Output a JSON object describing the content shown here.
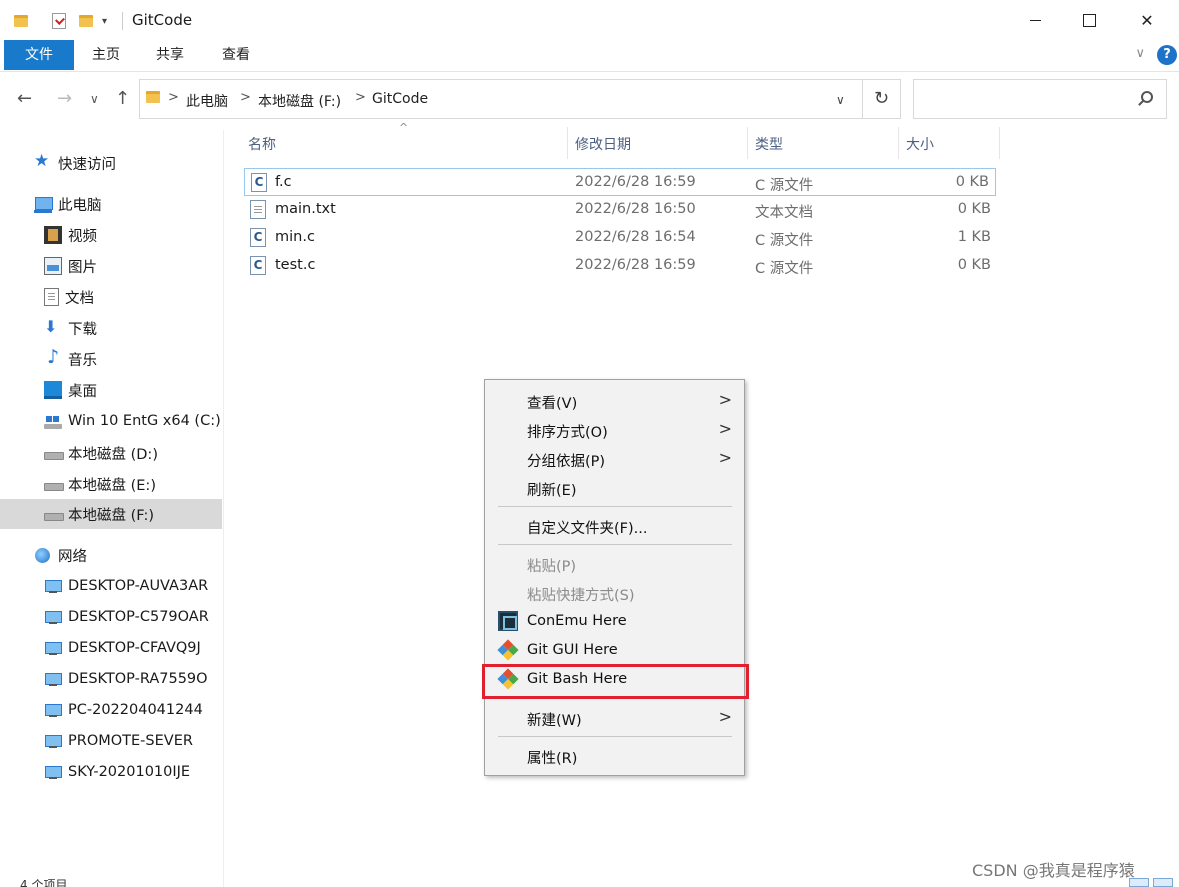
{
  "window": {
    "title": "GitCode",
    "controls": {
      "close": "✕"
    }
  },
  "ribbon": {
    "tabs": [
      "文件",
      "主页",
      "共享",
      "查看"
    ],
    "collapse": "∨",
    "help": "?"
  },
  "nav": {
    "back": "←",
    "forward": "→",
    "recent": "∨",
    "up": "↑",
    "breadcrumb": [
      "此电脑",
      "本地磁盘 (F:)",
      "GitCode"
    ],
    "separator": ">",
    "dropdown": "∨",
    "refresh": "↻",
    "search_placeholder": ""
  },
  "sidebar": {
    "quick_access": "快速访问",
    "this_pc": "此电脑",
    "pc_items": [
      "视频",
      "图片",
      "文档",
      "下载",
      "音乐",
      "桌面",
      "Win 10 EntG x64 (C:)",
      "本地磁盘 (D:)",
      "本地磁盘 (E:)",
      "本地磁盘 (F:)"
    ],
    "network": "网络",
    "hosts": [
      "DESKTOP-AUVA3AR",
      "DESKTOP-C579OAR",
      "DESKTOP-CFAVQ9J",
      "DESKTOP-RA7559O",
      "PC-202204041244",
      "PROMOTE-SEVER",
      "SKY-20201010IJE"
    ]
  },
  "file_list": {
    "columns": [
      "名称",
      "修改日期",
      "类型",
      "大小"
    ],
    "sort_indicator": "^",
    "rows": [
      {
        "name": "f.c",
        "modified": "2022/6/28 16:59",
        "type": "C 源文件",
        "size": "0 KB",
        "icon": "C"
      },
      {
        "name": "main.txt",
        "modified": "2022/6/28 16:50",
        "type": "文本文档",
        "size": "0 KB",
        "icon": ""
      },
      {
        "name": "min.c",
        "modified": "2022/6/28 16:54",
        "type": "C 源文件",
        "size": "1 KB",
        "icon": "C"
      },
      {
        "name": "test.c",
        "modified": "2022/6/28 16:59",
        "type": "C 源文件",
        "size": "0 KB",
        "icon": "C"
      }
    ]
  },
  "context_menu": {
    "arrow": ">",
    "view": "查看(V)",
    "sort_by": "排序方式(O)",
    "group_by": "分组依据(P)",
    "refresh": "刷新(E)",
    "customize_folder": "自定义文件夹(F)...",
    "paste": "粘贴(P)",
    "paste_shortcut": "粘贴快捷方式(S)",
    "conemu_here": "ConEmu Here",
    "git_gui_here": "Git GUI Here",
    "git_bash_here": "Git Bash Here",
    "new": "新建(W)",
    "properties": "属性(R)"
  },
  "status": {
    "item_count_fragment": "4 个项目"
  },
  "watermark": "CSDN @我真是程序猿",
  "colors": {
    "accent": "#1979ca",
    "highlight_box": "#e0202e",
    "menu_bg": "#f2f2f2"
  }
}
